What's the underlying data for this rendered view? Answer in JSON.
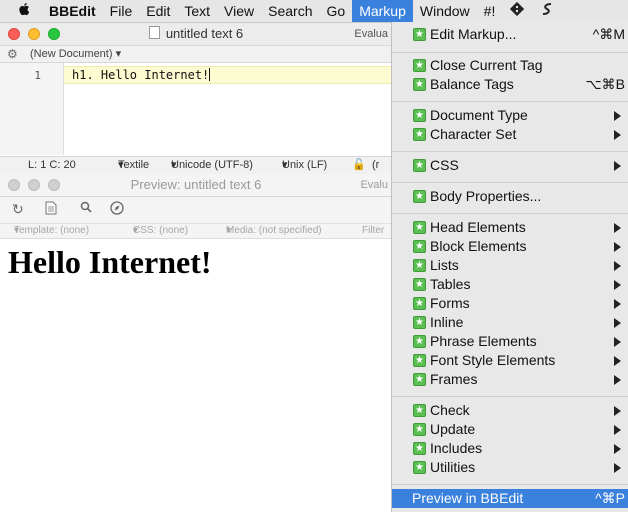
{
  "menubar": {
    "app_name": "BBEdit",
    "items": [
      "File",
      "Edit",
      "Text",
      "View",
      "Search",
      "Go",
      "Markup",
      "Window",
      "#!"
    ],
    "active": "Markup"
  },
  "editor": {
    "title": "untitled text 6",
    "title_extra": "Evalua",
    "doc_selector": "(New Document)",
    "line_number": "1",
    "code": "h1. Hello Internet!",
    "status": {
      "position": "L: 1 C: 20",
      "language": "Textile",
      "encoding": "Unicode (UTF-8)",
      "line_endings": "Unix (LF)",
      "extra": "(r"
    }
  },
  "preview": {
    "title": "Preview: untitled text 6",
    "title_extra": "Evalu",
    "template": "Template: (none)",
    "css": "CSS: (none)",
    "media": "Media: (not specified)",
    "filters": "Filter",
    "heading": "Hello Internet!"
  },
  "markup_menu": {
    "edit_markup": "Edit Markup...",
    "edit_markup_sc": "^⌘M",
    "close_tag": "Close Current Tag",
    "balance_tags": "Balance Tags",
    "balance_tags_sc": "⌥⌘B",
    "document_type": "Document Type",
    "character_set": "Character Set",
    "css": "CSS",
    "body_properties": "Body Properties...",
    "head_elements": "Head Elements",
    "block_elements": "Block Elements",
    "lists": "Lists",
    "tables": "Tables",
    "forms": "Forms",
    "inline": "Inline",
    "phrase_elements": "Phrase Elements",
    "font_style_elements": "Font Style Elements",
    "frames": "Frames",
    "check": "Check",
    "update": "Update",
    "includes": "Includes",
    "utilities": "Utilities",
    "preview": "Preview in BBEdit",
    "preview_sc": "^⌘P"
  },
  "colors": {
    "accent": "#3a80dd",
    "menu_icon": "#5bbf52",
    "current_line": "#fdfbd0"
  }
}
